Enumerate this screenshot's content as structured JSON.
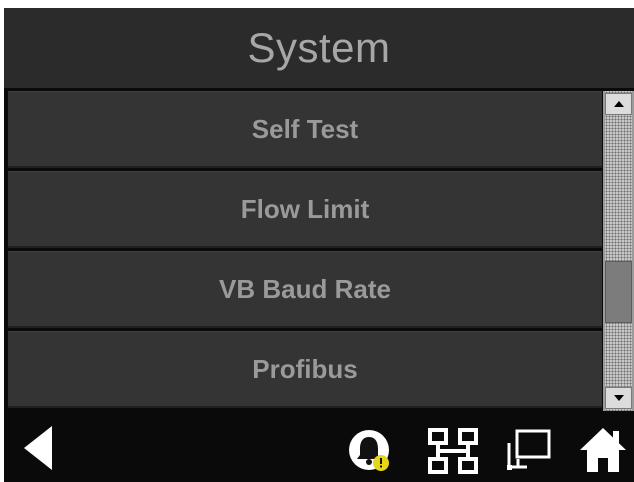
{
  "header": {
    "title": "System"
  },
  "menu": {
    "items": [
      {
        "label": "Self Test"
      },
      {
        "label": "Flow Limit"
      },
      {
        "label": "VB Baud Rate"
      },
      {
        "label": "Profibus"
      }
    ]
  },
  "scrollbar": {
    "position_fraction": 0.55
  },
  "bottom_bar": {
    "icons": [
      "back-arrow-icon",
      "alarm-bell-icon",
      "network-icon",
      "remote-terminal-icon",
      "home-icon"
    ]
  },
  "colors": {
    "background": "#0a0a0a",
    "title_bar": "#2b2b2b",
    "menu_item": "#343434",
    "text": "#9a9a9a",
    "alarm_badge": "#e6d51a",
    "icon": "#ffffff"
  }
}
